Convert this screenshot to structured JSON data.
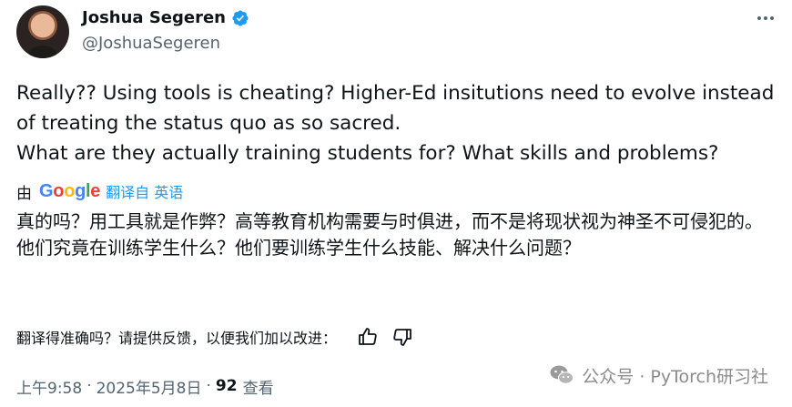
{
  "author": {
    "name": "Joshua Segeren",
    "handle": "@JoshuaSegeren",
    "verified_icon": "verified-badge-icon",
    "verified_color": "#1d9bf0"
  },
  "tweet": {
    "lines": [
      "Really?? Using tools is cheating? Higher-Ed insitutions need to evolve instead of treating the status quo as so sacred.",
      "What are they actually training students for? What skills and problems?"
    ]
  },
  "translation": {
    "by_label": "由",
    "google_letters": [
      "G",
      "o",
      "o",
      "g",
      "l",
      "e"
    ],
    "link_label": "翻译自 英语",
    "lines": [
      "真的吗？用工具就是作弊？高等教育机构需要与时俱进，而不是将现状视为神圣不可侵犯的。",
      "他们究竟在训练学生什么？他们要训练学生什么技能、解决什么问题？"
    ]
  },
  "feedback": {
    "question": "翻译得准确吗？请提供反馈，以便我们加以改进：",
    "thumbs_up_icon": "thumbs-up-icon",
    "thumbs_down_icon": "thumbs-down-icon"
  },
  "meta": {
    "time": "上午9:58",
    "dot1": "·",
    "date": "2025年5月8日",
    "dot2": "·",
    "views_count": "92",
    "views_label": "查看"
  },
  "watermark": {
    "text": "公众号 · PyTorch研习社",
    "icon": "wechat-icon"
  },
  "colors": {
    "text": "#0f1419",
    "secondary": "#536471",
    "link": "#1d9bf0"
  }
}
